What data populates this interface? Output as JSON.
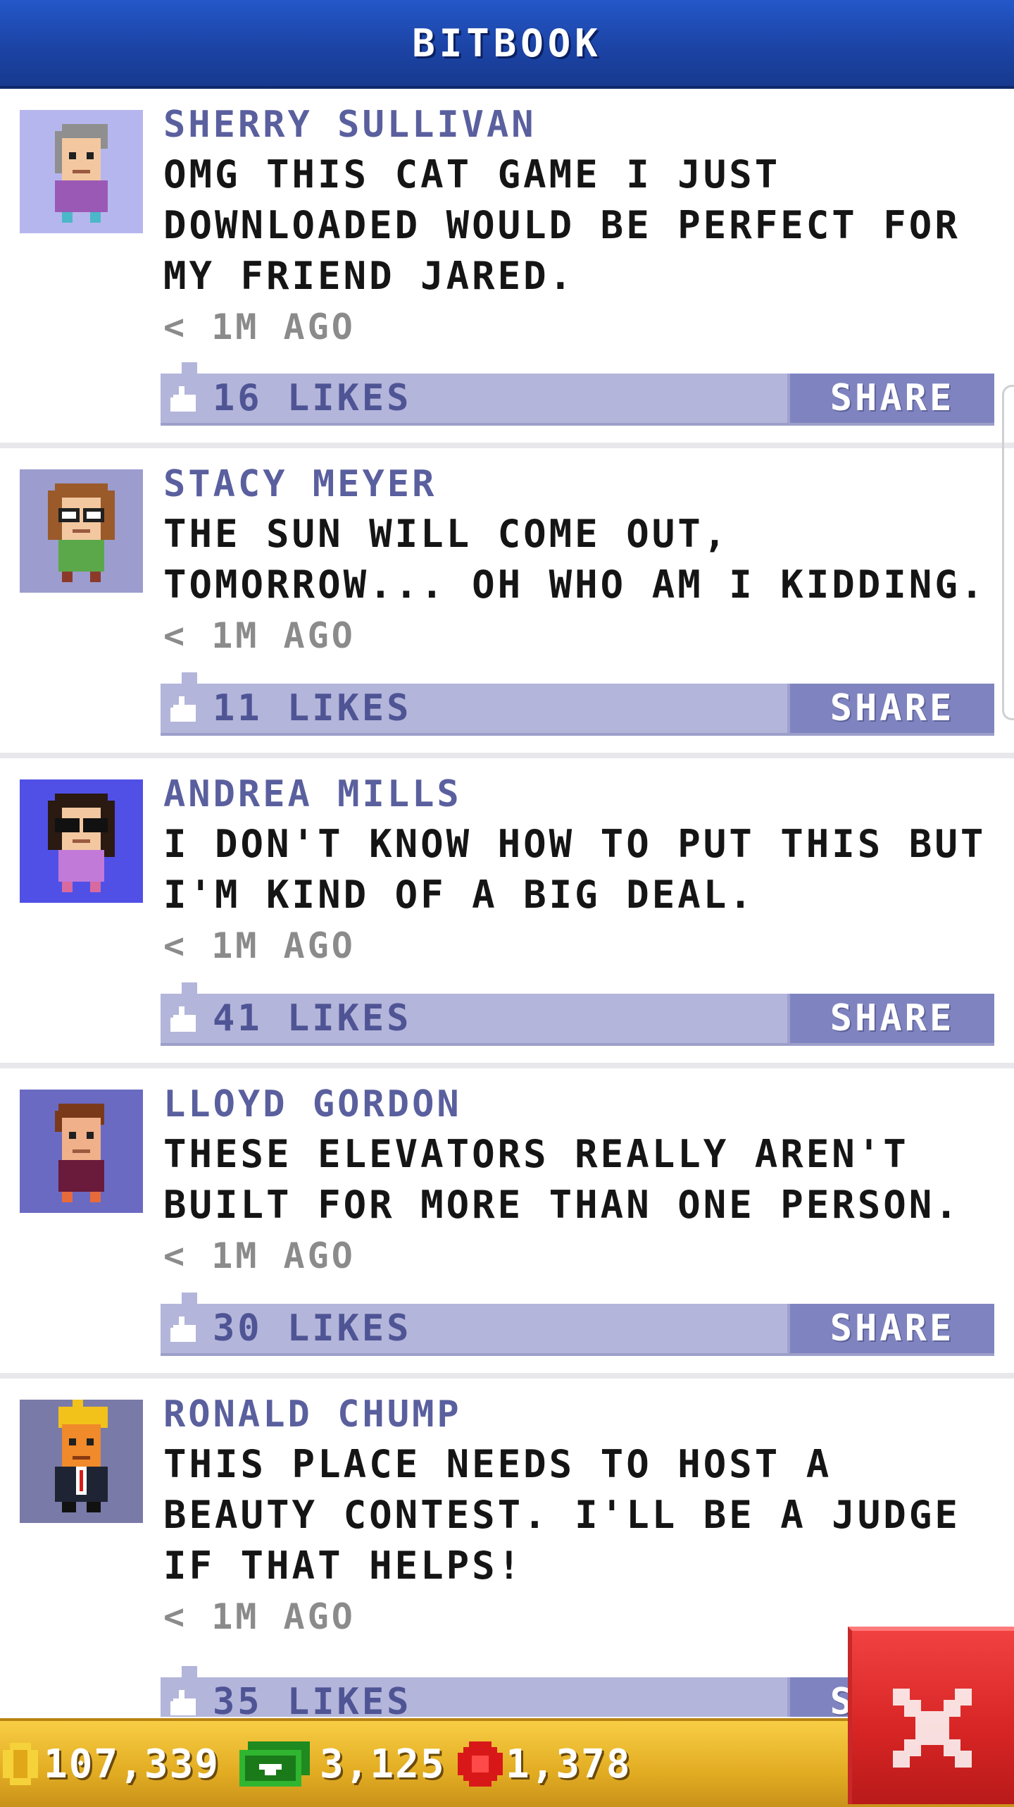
{
  "header": {
    "title": "BITBOOK"
  },
  "posts": [
    {
      "name": "SHERRY SULLIVAN",
      "text": "OMG THIS CAT GAME I JUST DOWNLOADED WOULD BE PERFECT FOR MY FRIEND JARED.",
      "time": "< 1M AGO",
      "likes": "16 LIKES",
      "share": "SHARE",
      "avatar_bg": "#b6b6ee"
    },
    {
      "name": "STACY MEYER",
      "text": "THE SUN WILL COME OUT, TOMORROW... OH WHO AM I KIDDING.",
      "time": "< 1M AGO",
      "likes": "11 LIKES",
      "share": "SHARE",
      "avatar_bg": "#9c9cce"
    },
    {
      "name": "ANDREA MILLS",
      "text": "I DON'T KNOW HOW TO PUT THIS BUT I'M KIND OF A BIG DEAL.",
      "time": "< 1M AGO",
      "likes": "41 LIKES",
      "share": "SHARE",
      "avatar_bg": "#5050e6"
    },
    {
      "name": "LLOYD GORDON",
      "text": "THESE ELEVATORS REALLY AREN'T BUILT FOR MORE THAN ONE PERSON.",
      "time": "< 1M AGO",
      "likes": "30 LIKES",
      "share": "SHARE",
      "avatar_bg": "#6a6ac2"
    },
    {
      "name": "RONALD CHUMP",
      "text": "THIS PLACE NEEDS TO HOST A BEAUTY CONTEST. I'LL BE A JUDGE IF THAT HELPS!",
      "time": "< 1M AGO",
      "likes": "35 LIKES",
      "share": "SHARE",
      "avatar_bg": "#7a7aa8"
    }
  ],
  "resources": {
    "coins": "107,339",
    "bux": "3,125",
    "gems": "1,378"
  }
}
